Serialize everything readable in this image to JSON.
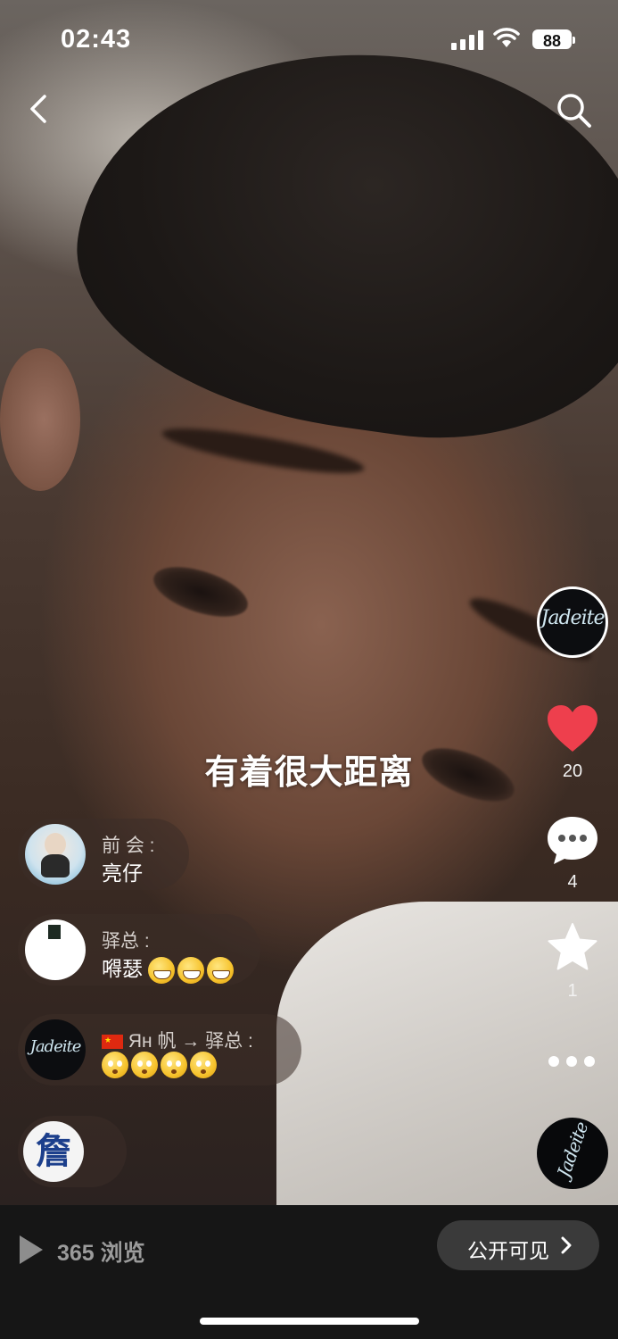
{
  "status_bar": {
    "time": "02:43",
    "battery": "88"
  },
  "video": {
    "caption": "有着很大距离"
  },
  "rail": {
    "author_logo": "Jadeite",
    "likes": "20",
    "comments": "4",
    "favorites": "1",
    "like_color": "#ee3f4d"
  },
  "comments": [
    {
      "name": "前 会 :",
      "text": "亮仔"
    },
    {
      "name": "驿总 :",
      "text": "嘚瑟"
    },
    {
      "name": "Ян 帆 → 驿总 :",
      "text": ""
    },
    {
      "name": "",
      "text": ""
    }
  ],
  "comment_avatars": {
    "fourth_glyph": "詹"
  },
  "bottom": {
    "views": "365 浏览",
    "visibility": "公开可见",
    "visibility_chevron": "›"
  },
  "icons": [
    "back-icon",
    "search-icon",
    "heart-icon",
    "comment-icon",
    "star-icon",
    "more-icon",
    "play-icon",
    "chevron-right-icon"
  ]
}
